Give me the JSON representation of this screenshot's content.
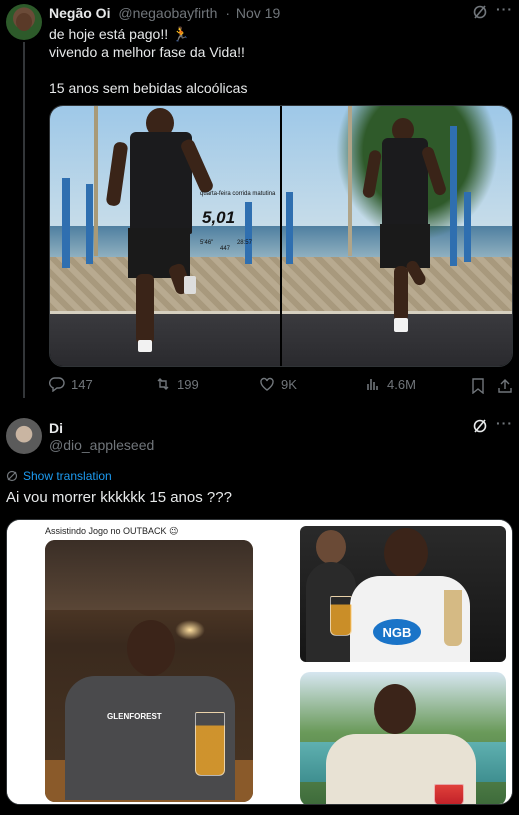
{
  "tweet1": {
    "name": "Negão Oi",
    "handle": "@negaobayfirth",
    "separator": "·",
    "date": "Nov 19",
    "text": "de hoje está pago!! 🏃\nvivendo a melhor fase da Vida!!\n\n15 anos sem bebidas alcoólicas",
    "overlay": {
      "label": "quarta-feira corrida matutina",
      "distance": "5,01",
      "pace": "5'46\"",
      "time": "28:57",
      "elev": "447"
    },
    "actions": {
      "replies": "147",
      "reposts": "199",
      "likes": "9K",
      "views": "4.6M"
    }
  },
  "tweet2": {
    "name": "Di",
    "handle": "@dio_appleseed",
    "translate": "Show translation",
    "text": "Ai vou morrer kkkkkk 15 anos ???",
    "caption_left": "Assistindo Jogo no OUTBACK 😉",
    "shirt_left": "GLENFOREST",
    "shirt_mid": "NGB"
  },
  "icons": {
    "more": "more-icon",
    "grok": "grok-icon",
    "reply": "reply-icon",
    "repost": "repost-icon",
    "like": "like-icon",
    "views": "views-icon",
    "bookmark": "bookmark-icon",
    "share": "share-icon"
  },
  "colors": {
    "background": "#000000",
    "text": "#e7e9ea",
    "muted": "#71767b",
    "link": "#1d9bf0"
  }
}
